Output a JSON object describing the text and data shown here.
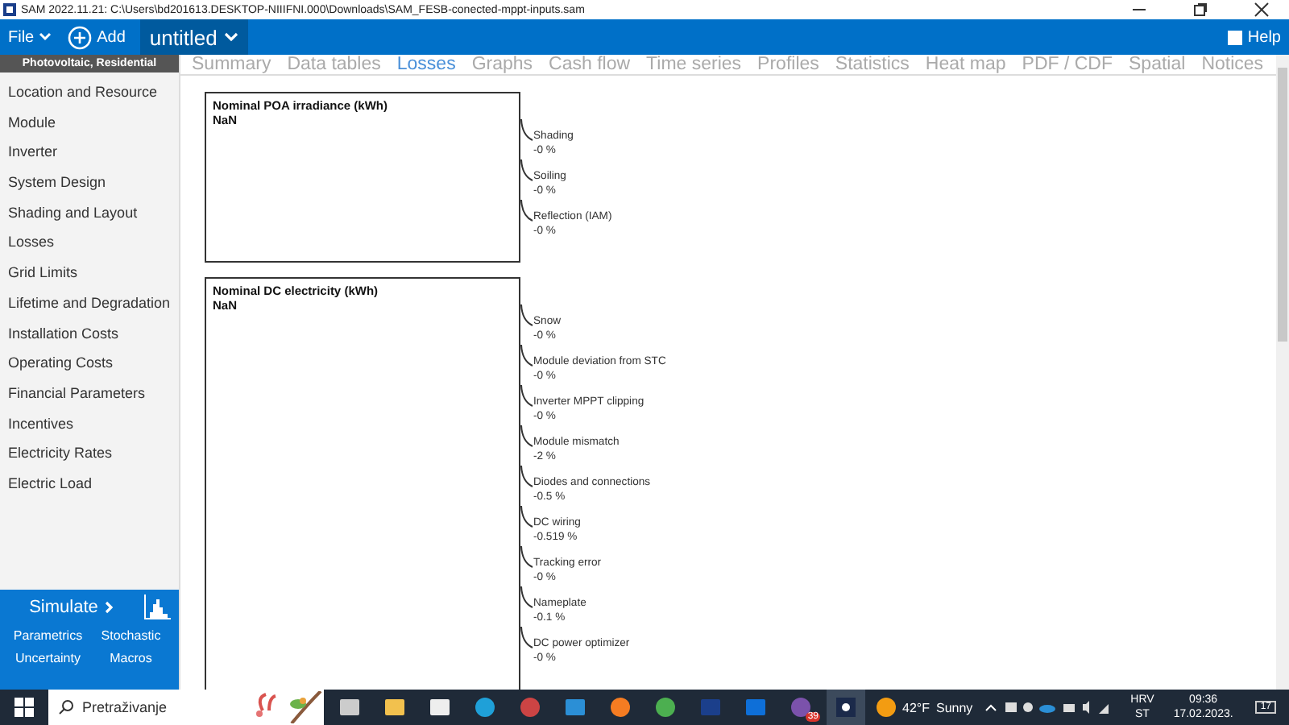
{
  "window": {
    "title": "SAM 2022.11.21: C:\\Users\\bd201613.DESKTOP-NIIIFNI.000\\Downloads\\SAM_FESB-conected-mppt-inputs.sam"
  },
  "toolbar": {
    "file": "File",
    "add": "Add",
    "case": "untitled",
    "help": "Help"
  },
  "sidebar": {
    "header": "Photovoltaic, Residential",
    "items": [
      {
        "label": "Location and Resource",
        "selected": false
      },
      {
        "label": "Module",
        "selected": false
      },
      {
        "label": "Inverter",
        "selected": false
      },
      {
        "label": "System Design",
        "selected": false
      },
      {
        "label": "Shading and Layout",
        "selected": false
      },
      {
        "label": "Losses",
        "selected": false
      },
      {
        "label": "Grid Limits",
        "selected": false
      },
      {
        "label": "Lifetime and Degradation",
        "selected": false
      },
      {
        "label": "Installation Costs",
        "selected": false
      },
      {
        "label": "Operating Costs",
        "selected": false
      },
      {
        "label": "Financial Parameters",
        "selected": false
      },
      {
        "label": "Incentives",
        "selected": false
      },
      {
        "label": "Electricity Rates",
        "selected": false
      },
      {
        "label": "Electric Load",
        "selected": false
      }
    ],
    "simulate": "Simulate",
    "links": [
      "Parametrics",
      "Stochastic",
      "Uncertainty",
      "Macros"
    ]
  },
  "tabs": [
    {
      "label": "Summary",
      "selected": false
    },
    {
      "label": "Data tables",
      "selected": false
    },
    {
      "label": "Losses",
      "selected": true
    },
    {
      "label": "Graphs",
      "selected": false
    },
    {
      "label": "Cash flow",
      "selected": false
    },
    {
      "label": "Time series",
      "selected": false
    },
    {
      "label": "Profiles",
      "selected": false
    },
    {
      "label": "Statistics",
      "selected": false
    },
    {
      "label": "Heat map",
      "selected": false
    },
    {
      "label": "PDF / CDF",
      "selected": false
    },
    {
      "label": "Spatial",
      "selected": false
    },
    {
      "label": "Notices",
      "selected": false
    }
  ],
  "blocks": [
    {
      "title": "Nominal POA irradiance (kWh)",
      "value": "NaN",
      "losses": [
        {
          "name": "Shading",
          "value": "-0 %"
        },
        {
          "name": "Soiling",
          "value": "-0 %"
        },
        {
          "name": "Reflection (IAM)",
          "value": "-0 %"
        }
      ]
    },
    {
      "title": "Nominal DC electricity (kWh)",
      "value": "NaN",
      "losses": [
        {
          "name": "Snow",
          "value": "-0 %"
        },
        {
          "name": "Module deviation from STC",
          "value": "-0 %"
        },
        {
          "name": "Inverter MPPT clipping",
          "value": "-0 %"
        },
        {
          "name": "Module mismatch",
          "value": "-2 %"
        },
        {
          "name": "Diodes and connections",
          "value": "-0.5 %"
        },
        {
          "name": "DC wiring",
          "value": "-0.519 %"
        },
        {
          "name": "Tracking error",
          "value": "-0 %"
        },
        {
          "name": "Nameplate",
          "value": "-0.1 %"
        },
        {
          "name": "DC power optimizer",
          "value": "-0 %"
        }
      ]
    }
  ],
  "taskbar": {
    "search": "Pretraživanje",
    "apps": [
      {
        "kind": "taskview",
        "selected": false
      },
      {
        "kind": "folder",
        "selected": false
      },
      {
        "kind": "store",
        "selected": false
      },
      {
        "kind": "edge",
        "selected": false
      },
      {
        "kind": "tool",
        "selected": false
      },
      {
        "kind": "mail",
        "selected": false
      },
      {
        "kind": "firefox",
        "selected": false
      },
      {
        "kind": "chrome",
        "selected": false
      },
      {
        "kind": "pv",
        "selected": false
      },
      {
        "kind": "teamviewer",
        "selected": false
      },
      {
        "kind": "viber",
        "selected": false,
        "badge": "39"
      },
      {
        "kind": "sam",
        "selected": true
      }
    ],
    "weather_temp": "42°F",
    "weather": "Sunny",
    "lang": "HRV",
    "lang_sub": "ST",
    "time": "09:36",
    "date": "17.02.2023.",
    "notifications": "17"
  }
}
